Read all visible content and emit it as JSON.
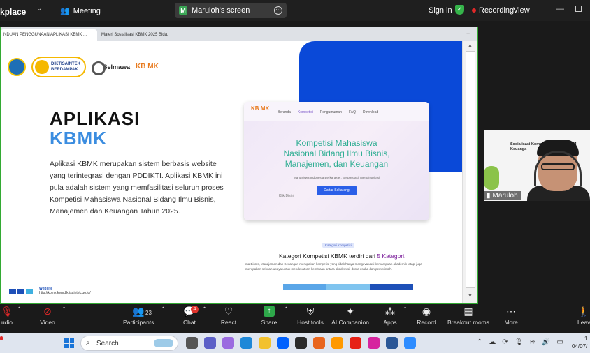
{
  "top_bar": {
    "app_name": "kplace",
    "meeting_label": "Meeting",
    "share_title": "Maruloh's screen",
    "share_badge": "M",
    "sign_in": "Sign in",
    "recording": "Recording",
    "view": "View"
  },
  "browser": {
    "tabs": [
      "NDUAN PENGGUNAAN APLIKASI KBMK ...",
      "Materi Sosialisasi KBMK 2025 Bida..."
    ]
  },
  "slide": {
    "logo_dikti": "DIKTISAINTEK BERDAMPAK",
    "logo_belmawa": "Belmawa",
    "logo_kbmk": "KB MK",
    "heading_line1": "APLIKASI",
    "heading_line2": "KBMK",
    "description": "Aplikasi KBMK merupakan sistem berbasis website yang terintegrasi dengan PDDIKTI. Aplikasi KBMK ini pula adalah sistem yang memfasilitasi seluruh proses Kompetisi Mahasiswa Nasional Bidang Ilmu Bisnis, Manajemen dan Keuangan Tahun 2025.",
    "website_label": "Website",
    "website_url": "http://kbmk.kemdiktisaintek.go.id/"
  },
  "site_preview": {
    "logo": "KB MK",
    "nav": [
      "Beranda",
      "Kompetisi",
      "Pengumuman",
      "FAQ",
      "Download"
    ],
    "title_line1": "Kompetisi Mahasiswa",
    "title_line2": "Nasional Bidang Ilmu Bisnis,",
    "title_line3": "Manajemen, dan Keuangan",
    "subtitle": "Mahasiswa Indonesia Berkarakter, Berprestasi, Menginspirasi",
    "cta": "Daftar Sekarang",
    "klik": "Klik Disini"
  },
  "kategori": {
    "pill": "Kategori Kompetisi",
    "title_prefix": "Kategori Kompetisi KBMK terdiri dari ",
    "title_highlight": "5 Kategori.",
    "desc": "ma Bisnis, Manajemen dan Keuangan merupakan kompetisi yang tidak hanya mengevaluasi kemampuan akademik tetapi juga merupakan sebuah upaya untuk mendekatkan kemitraan antara akademisi, dunia usaha dan pemerintah."
  },
  "participant": {
    "name": "Maruloh",
    "slide_text": "Sosialisasi Kompe Bidang Bisnis, M Keuanga"
  },
  "toolbar": {
    "audio": "udio",
    "video": "Video",
    "participants": "Participants",
    "participants_count": "23",
    "chat": "Chat",
    "chat_badge": "4",
    "react": "React",
    "share": "Share",
    "host_tools": "Host tools",
    "ai_companion": "AI Companion",
    "apps": "Apps",
    "record": "Record",
    "breakout": "Breakout rooms",
    "more": "More",
    "leave": "Leav"
  },
  "taskbar": {
    "search": "Search",
    "date": "04/07/",
    "time": "1"
  },
  "colors": {
    "accent_blue": "#0a49d8",
    "kbmk_blue": "#3b8de0",
    "share_green": "#2ea84a",
    "record_red": "#e02828"
  }
}
